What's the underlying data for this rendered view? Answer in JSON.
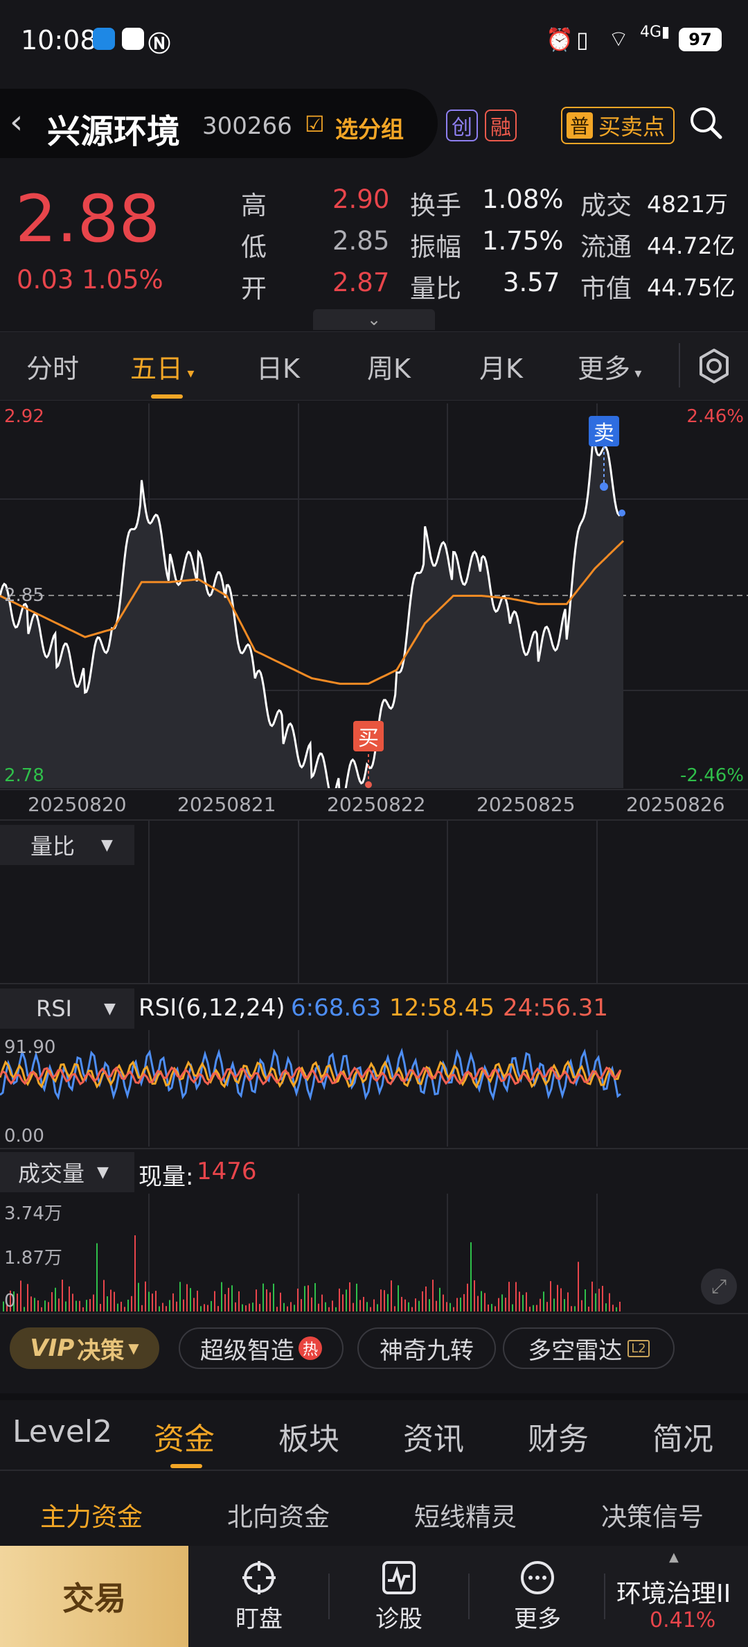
{
  "status_bar": {
    "time": "10:08",
    "battery": "97",
    "network": "4G"
  },
  "header": {
    "stock_name": "兴源环境",
    "stock_code": "300266",
    "watchlist_label": "选分组",
    "tag_chuang": "创",
    "tag_rong": "融",
    "buy_sell_badge": "普",
    "buy_sell_label": "买卖点"
  },
  "quote": {
    "price": "2.88",
    "change": "0.03",
    "change_pct": "1.05%",
    "rows": [
      {
        "l1": "高",
        "v1": "2.90",
        "l2": "换手",
        "v2": "1.08%",
        "l3": "成交",
        "v3": "4821万"
      },
      {
        "l1": "低",
        "v1": "2.85",
        "l2": "振幅",
        "v2": "1.75%",
        "l3": "流通",
        "v3": "44.72亿"
      },
      {
        "l1": "开",
        "v1": "2.87",
        "l2": "量比",
        "v2": "3.57",
        "l3": "市值",
        "v3": "44.75亿"
      }
    ]
  },
  "period_tabs": {
    "items": [
      "分时",
      "五日",
      "日K",
      "周K",
      "月K",
      "更多"
    ],
    "active": "五日"
  },
  "main_chart": {
    "y_top": "2.92",
    "y_mid": "2.85",
    "y_bottom": "2.78",
    "pct_top": "2.46%",
    "pct_bottom": "-2.46%",
    "sell_marker": "卖",
    "buy_marker": "买",
    "dates": [
      "20250820",
      "20250821",
      "20250822",
      "20250825",
      "20250826"
    ]
  },
  "panels": {
    "volume_ratio_label": "量比",
    "rsi_label": "RSI",
    "rsi_title": "RSI(6,12,24)",
    "rsi6": "6:68.63",
    "rsi12": "12:58.45",
    "rsi24": "24:56.31",
    "rsi_top": "91.90",
    "rsi_bottom": "0.00",
    "volume_label": "成交量",
    "current_volume_label": "现量:",
    "current_volume": "1476",
    "vol_top": "3.74万",
    "vol_mid": "1.87万",
    "vol_zero": "0"
  },
  "features": {
    "vip_label": "VIP",
    "vip_text": "决策",
    "chip1": "超级智造",
    "chip1_badge": "热",
    "chip2": "神奇九转",
    "chip3": "多空雷达",
    "chip3_badge": "L2"
  },
  "info_tabs": {
    "items": [
      "Level2",
      "资金",
      "板块",
      "资讯",
      "财务",
      "简况"
    ],
    "active": "资金"
  },
  "sub_tabs": {
    "items": [
      "主力资金",
      "北向资金",
      "短线精灵",
      "决策信号"
    ]
  },
  "bottom_nav": {
    "trade": "交易",
    "watch": "盯盘",
    "diagnose": "诊股",
    "more": "更多",
    "sector_name": "环境治理II",
    "sector_pct": "0.41%"
  },
  "chart_data": {
    "type": "line",
    "title": "",
    "categories": [
      "20250820",
      "20250821",
      "20250822",
      "20250825",
      "20250826"
    ],
    "ylim": [
      2.78,
      2.92
    ],
    "series": [
      {
        "name": "",
        "values": [
          2.85,
          2.84,
          2.83,
          2.82,
          2.84,
          2.89,
          2.86,
          2.86,
          2.85,
          2.82,
          2.8,
          2.79,
          2.78,
          2.79,
          2.82,
          2.87,
          2.86,
          2.86,
          2.84,
          2.83,
          2.84,
          2.91,
          2.88
        ]
      },
      {
        "name": "",
        "values": [
          2.85,
          2.845,
          2.84,
          2.835,
          2.838,
          2.855,
          2.855,
          2.856,
          2.85,
          2.83,
          2.825,
          2.82,
          2.818,
          2.818,
          2.823,
          2.84,
          2.85,
          2.85,
          2.849,
          2.847,
          2.847,
          2.86,
          2.87
        ]
      }
    ]
  }
}
